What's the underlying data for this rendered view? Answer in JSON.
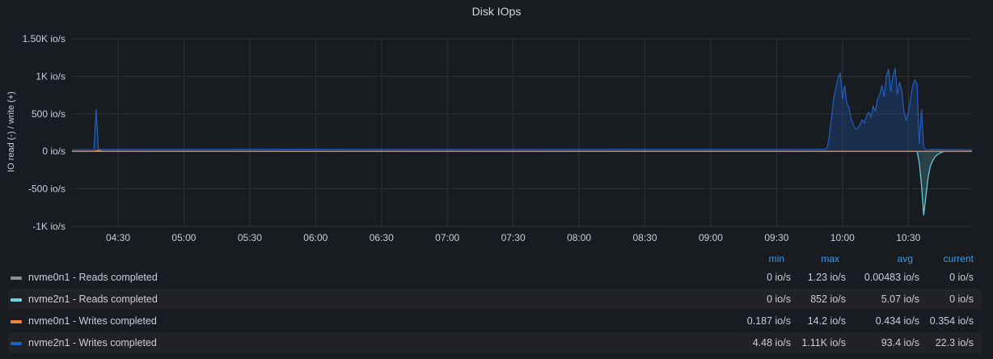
{
  "panel": {
    "title": "Disk IOps"
  },
  "chart_data": {
    "type": "area",
    "title": "Disk IOps",
    "ylabel": "IO read (-) / write (+)",
    "yticks": [
      "1.50K io/s",
      "1K io/s",
      "500 io/s",
      "0 io/s",
      "-500 io/s",
      "-1K io/s"
    ],
    "ytick_values": [
      1500,
      1000,
      500,
      0,
      -500,
      -1000
    ],
    "ylim": [
      -1000,
      1500
    ],
    "xticks": [
      "04:30",
      "05:00",
      "05:30",
      "06:00",
      "06:30",
      "07:00",
      "07:30",
      "08:00",
      "08:30",
      "09:00",
      "09:30",
      "10:00",
      "10:30"
    ],
    "xtick_values": [
      270,
      300,
      330,
      360,
      390,
      420,
      450,
      480,
      510,
      540,
      570,
      600,
      630
    ],
    "xlim": [
      249,
      659
    ],
    "grid": true,
    "series": [
      {
        "name": "nvme0n1 - Reads completed",
        "color": "#8e8e8e",
        "points": [
          [
            249,
            0
          ],
          [
            659,
            0
          ]
        ]
      },
      {
        "name": "nvme2n1 - Reads completed",
        "color": "#6ed0e0",
        "points": [
          [
            249,
            0
          ],
          [
            634,
            0
          ],
          [
            635,
            -150
          ],
          [
            636,
            -450
          ],
          [
            637,
            -852
          ],
          [
            638,
            -600
          ],
          [
            639,
            -350
          ],
          [
            640,
            -200
          ],
          [
            641,
            -130
          ],
          [
            642,
            -80
          ],
          [
            643,
            -50
          ],
          [
            644,
            -30
          ],
          [
            645,
            -15
          ],
          [
            646,
            -5
          ],
          [
            647,
            0
          ],
          [
            659,
            0
          ]
        ]
      },
      {
        "name": "nvme0n1 - Writes completed",
        "color": "#ef843c",
        "points": [
          [
            249,
            0
          ],
          [
            259,
            0
          ],
          [
            260,
            10
          ],
          [
            261,
            14
          ],
          [
            262,
            8
          ],
          [
            263,
            0
          ],
          [
            659,
            0
          ]
        ]
      },
      {
        "name": "nvme2n1 - Writes completed",
        "color": "#1f60c4",
        "fill": "#1a3d5c",
        "points": [
          [
            249,
            22
          ],
          [
            259,
            22
          ],
          [
            260,
            560
          ],
          [
            261,
            40
          ],
          [
            262,
            25
          ],
          [
            350,
            28
          ],
          [
            420,
            25
          ],
          [
            500,
            27
          ],
          [
            580,
            26
          ],
          [
            592,
            28
          ],
          [
            593,
            40
          ],
          [
            594,
            200
          ],
          [
            595,
            450
          ],
          [
            596,
            700
          ],
          [
            597,
            850
          ],
          [
            598,
            980
          ],
          [
            599,
            1050
          ],
          [
            600,
            700
          ],
          [
            601,
            880
          ],
          [
            602,
            640
          ],
          [
            603,
            580
          ],
          [
            604,
            430
          ],
          [
            605,
            350
          ],
          [
            606,
            300
          ],
          [
            607,
            310
          ],
          [
            608,
            360
          ],
          [
            609,
            420
          ],
          [
            610,
            380
          ],
          [
            611,
            480
          ],
          [
            612,
            520
          ],
          [
            613,
            460
          ],
          [
            614,
            600
          ],
          [
            615,
            540
          ],
          [
            616,
            700
          ],
          [
            617,
            760
          ],
          [
            618,
            880
          ],
          [
            619,
            720
          ],
          [
            620,
            1000
          ],
          [
            621,
            1100
          ],
          [
            622,
            800
          ],
          [
            623,
            1000
          ],
          [
            624,
            1110
          ],
          [
            625,
            760
          ],
          [
            626,
            920
          ],
          [
            627,
            820
          ],
          [
            628,
            540
          ],
          [
            629,
            420
          ],
          [
            630,
            520
          ],
          [
            631,
            700
          ],
          [
            632,
            880
          ],
          [
            633,
            950
          ],
          [
            634,
            900
          ],
          [
            635,
            100
          ],
          [
            636,
            560
          ],
          [
            637,
            60
          ],
          [
            638,
            20
          ],
          [
            639,
            22
          ],
          [
            640,
            25
          ],
          [
            659,
            22
          ]
        ]
      }
    ]
  },
  "legend": {
    "headers": {
      "min": "min",
      "max": "max",
      "avg": "avg",
      "current": "current"
    },
    "rows": [
      {
        "name": "nvme0n1 - Reads completed",
        "color": "#8e8e8e",
        "min": "0 io/s",
        "max": "1.23 io/s",
        "avg": "0.00483 io/s",
        "current": "0 io/s"
      },
      {
        "name": "nvme2n1 - Reads completed",
        "color": "#6ed0e0",
        "min": "0 io/s",
        "max": "852 io/s",
        "avg": "5.07 io/s",
        "current": "0 io/s"
      },
      {
        "name": "nvme0n1 - Writes completed",
        "color": "#ef843c",
        "min": "0.187 io/s",
        "max": "14.2 io/s",
        "avg": "0.434 io/s",
        "current": "0.354 io/s"
      },
      {
        "name": "nvme2n1 - Writes completed",
        "color": "#1f60c4",
        "min": "4.48 io/s",
        "max": "1.11K io/s",
        "avg": "93.4 io/s",
        "current": "22.3 io/s"
      }
    ]
  }
}
